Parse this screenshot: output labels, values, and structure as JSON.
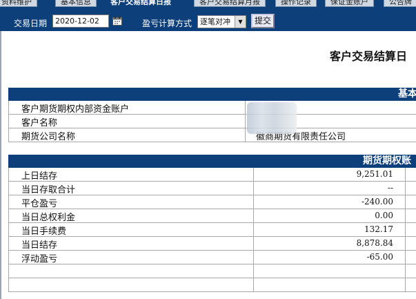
{
  "tabs": [
    {
      "label": "资料维护"
    },
    {
      "label": "基本信息"
    },
    {
      "label": "客户交易结算日报"
    },
    {
      "label": "客户交易结算月报"
    },
    {
      "label": "操作记录"
    },
    {
      "label": "保证金账户"
    },
    {
      "label": "公告牌"
    }
  ],
  "toolbar": {
    "date_label": "交易日期",
    "date_value": "2020-12-02",
    "method_label": "盈亏计算方式",
    "method_value": "逐笔对冲",
    "submit_label": "提交"
  },
  "page_title": "客户交易结算日",
  "basic_section": {
    "header": "基本",
    "rows": [
      {
        "label": "客户期货期权内部资金账户",
        "value": ""
      },
      {
        "label": "客户名称",
        "value": ""
      },
      {
        "label": "期货公司名称",
        "value": "徽商期货有限责任公司"
      }
    ]
  },
  "account_section": {
    "header": "期货期权账",
    "rows": [
      {
        "label": "上日结存",
        "value": "9,251.01"
      },
      {
        "label": "当日存取合计",
        "value": "--"
      },
      {
        "label": "平仓盈亏",
        "value": "-240.00"
      },
      {
        "label": "当日总权利金",
        "value": "0.00"
      },
      {
        "label": "当日手续费",
        "value": "132.17"
      },
      {
        "label": "当日结存",
        "value": "8,878.84"
      },
      {
        "label": "浮动盈亏",
        "value": "-65.00"
      },
      {
        "label": "",
        "value": ""
      },
      {
        "label": "",
        "value": ""
      }
    ]
  },
  "colors": {
    "nav": "#0d3f7a",
    "header": "#0d3f7a"
  }
}
